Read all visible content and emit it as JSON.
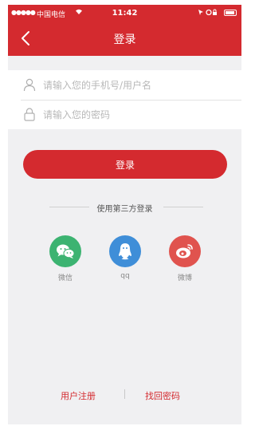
{
  "status_bar": {
    "signal": "●●●●●",
    "carrier": "中国电信",
    "time": "11:42"
  },
  "nav": {
    "title": "登录"
  },
  "form": {
    "username_placeholder": "请输入您的手机号/用户名",
    "password_placeholder": "请输入您的密码",
    "login_label": "登录"
  },
  "third_party": {
    "title": "使用第三方登录",
    "options": [
      {
        "label": "微信",
        "icon": "wechat-icon",
        "color": "#3cb371"
      },
      {
        "label": "qq",
        "icon": "qq-icon",
        "color": "#3f8ed8"
      },
      {
        "label": "微博",
        "icon": "weibo-icon",
        "color": "#e0534e"
      }
    ]
  },
  "footer": {
    "register_label": "用户注册",
    "forgot_label": "找回密码"
  },
  "colors": {
    "brand_red": "#d42a2f",
    "background": "#f0f0f2"
  }
}
